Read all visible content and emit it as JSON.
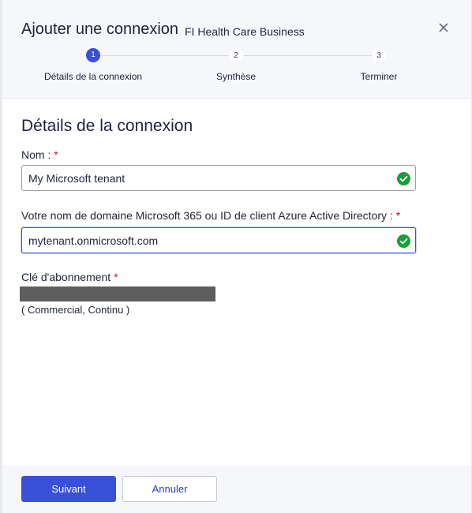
{
  "dialog": {
    "title": "Ajouter une connexion",
    "organization": "FI Health Care Business"
  },
  "stepper": {
    "steps": [
      {
        "number": "1",
        "label": "Détails de la connexion",
        "active": true
      },
      {
        "number": "2",
        "label": "Synthèse",
        "active": false
      },
      {
        "number": "3",
        "label": "Terminer",
        "active": false
      }
    ]
  },
  "form": {
    "section_title": "Détails de la connexion",
    "name_label": "Nom :",
    "name_value": "My Microsoft tenant",
    "domain_label": "Votre nom de domaine Microsoft 365 ou ID de client Azure Active Directory :",
    "domain_value": "mytenant.onmicrosoft.com",
    "subscription_label": "Clé d'abonnement",
    "subscription_type": "( Commercial, Continu )",
    "required_marker": "*"
  },
  "footer": {
    "next_label": "Suivant",
    "cancel_label": "Annuler"
  },
  "colors": {
    "accent": "#3b50d8",
    "valid": "#1a9e3a",
    "required": "#c8102e"
  },
  "icons": {
    "close": "close-icon",
    "valid": "check-circle-icon"
  }
}
